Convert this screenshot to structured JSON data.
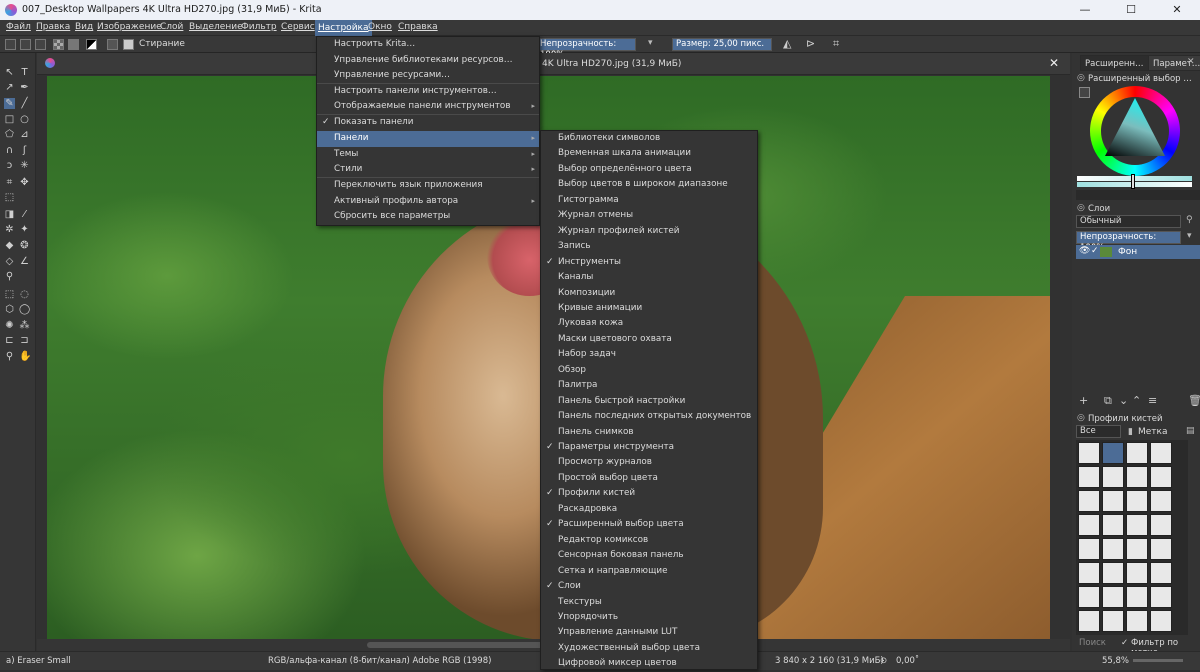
{
  "window": {
    "title": "007_Desktop Wallpapers 4K Ultra HD270.jpg (31,9 МиБ)  - Krita",
    "minimize": "—",
    "maximize": "☐",
    "close": "✕"
  },
  "menubar": [
    "Файл",
    "Правка",
    "Вид",
    "Изображение",
    "Слой",
    "Выделение",
    "Фильтр",
    "Сервис",
    "Настройка",
    "Окно",
    "Справка"
  ],
  "tool_options": {
    "blend_mode": "Стирание",
    "opacity": "Непрозрачность: 100%",
    "size": "Размер: 25,00 пикс."
  },
  "document_tab": {
    "title": "4K Ultra HD270.jpg (31,9 МиБ)",
    "close": "✕"
  },
  "settings_menu": [
    {
      "label": "Настроить Krita…",
      "check": false,
      "sub": false
    },
    {
      "label": "Управление библиотеками ресурсов…",
      "check": false,
      "sub": false
    },
    {
      "label": "Управление ресурсами…",
      "check": false,
      "sub": false
    },
    {
      "label": "Настроить панели инструментов…",
      "check": false,
      "sub": false
    },
    {
      "label": "Отображаемые панели инструментов",
      "check": false,
      "sub": true
    },
    {
      "label": "Показать панели",
      "check": true,
      "sub": false
    },
    {
      "label": "Панели",
      "check": false,
      "sub": true
    },
    {
      "label": "Темы",
      "check": false,
      "sub": true
    },
    {
      "label": "Стили",
      "check": false,
      "sub": true
    },
    {
      "label": "Переключить язык приложения",
      "check": false,
      "sub": false
    },
    {
      "label": "Активный профиль автора",
      "check": false,
      "sub": true
    },
    {
      "label": "Сбросить все параметры",
      "check": false,
      "sub": false
    }
  ],
  "dockers_menu": [
    {
      "label": "Библиотеки символов",
      "check": false
    },
    {
      "label": "Временная шкала анимации",
      "check": false
    },
    {
      "label": "Выбор определённого цвета",
      "check": false
    },
    {
      "label": "Выбор цветов в широком диапазоне",
      "check": false
    },
    {
      "label": "Гистограмма",
      "check": false
    },
    {
      "label": "Журнал отмены",
      "check": false
    },
    {
      "label": "Журнал профилей кистей",
      "check": false
    },
    {
      "label": "Запись",
      "check": false
    },
    {
      "label": "Инструменты",
      "check": true
    },
    {
      "label": "Каналы",
      "check": false
    },
    {
      "label": "Композиции",
      "check": false
    },
    {
      "label": "Кривые анимации",
      "check": false
    },
    {
      "label": "Луковая кожа",
      "check": false
    },
    {
      "label": "Маски цветового охвата",
      "check": false
    },
    {
      "label": "Набор задач",
      "check": false
    },
    {
      "label": "Обзор",
      "check": false
    },
    {
      "label": "Палитра",
      "check": false
    },
    {
      "label": "Панель быстрой настройки",
      "check": false
    },
    {
      "label": "Панель последних открытых документов",
      "check": false
    },
    {
      "label": "Панель снимков",
      "check": false
    },
    {
      "label": "Параметры инструмента",
      "check": true
    },
    {
      "label": "Просмотр журналов",
      "check": false
    },
    {
      "label": "Простой выбор цвета",
      "check": false
    },
    {
      "label": "Профили кистей",
      "check": true
    },
    {
      "label": "Раскадровка",
      "check": false
    },
    {
      "label": "Расширенный выбор цвета",
      "check": true
    },
    {
      "label": "Редактор комиксов",
      "check": false
    },
    {
      "label": "Сенсорная боковая панель",
      "check": false
    },
    {
      "label": "Сетка и направляющие",
      "check": false
    },
    {
      "label": "Слои",
      "check": true
    },
    {
      "label": "Текстуры",
      "check": false
    },
    {
      "label": "Упорядочить",
      "check": false
    },
    {
      "label": "Управление данными LUT",
      "check": false
    },
    {
      "label": "Художественный выбор цвета",
      "check": false
    },
    {
      "label": "Цифровой миксер цветов",
      "check": false
    }
  ],
  "right_panel": {
    "tab1": "Расширенн…",
    "tab2": "Парамет…",
    "color_header": "Расширенный выбор …",
    "layers_header": "Слои",
    "blend": "Обычный",
    "opacity": "Непрозрачность:  100%",
    "layer_name": "Фон",
    "brushes_header": "Профили кистей",
    "brush_filter": "Все",
    "tag_label": "Метка",
    "search_placeholder": "Поиск",
    "filter_tag": "Фильтр по метке"
  },
  "statusbar": {
    "brush": "a) Eraser Small",
    "colorspace": "RGB/альфа-канал (8-бит/канал)  Adobe RGB (1998)",
    "dimensions": "3 840 x 2 160 (31,9 МиБ)",
    "rotation": "0,00˚",
    "zoom": "55,8%"
  },
  "colors": {
    "accent": "#4c6c96",
    "background": "#313131",
    "menu_bg": "#353535"
  }
}
